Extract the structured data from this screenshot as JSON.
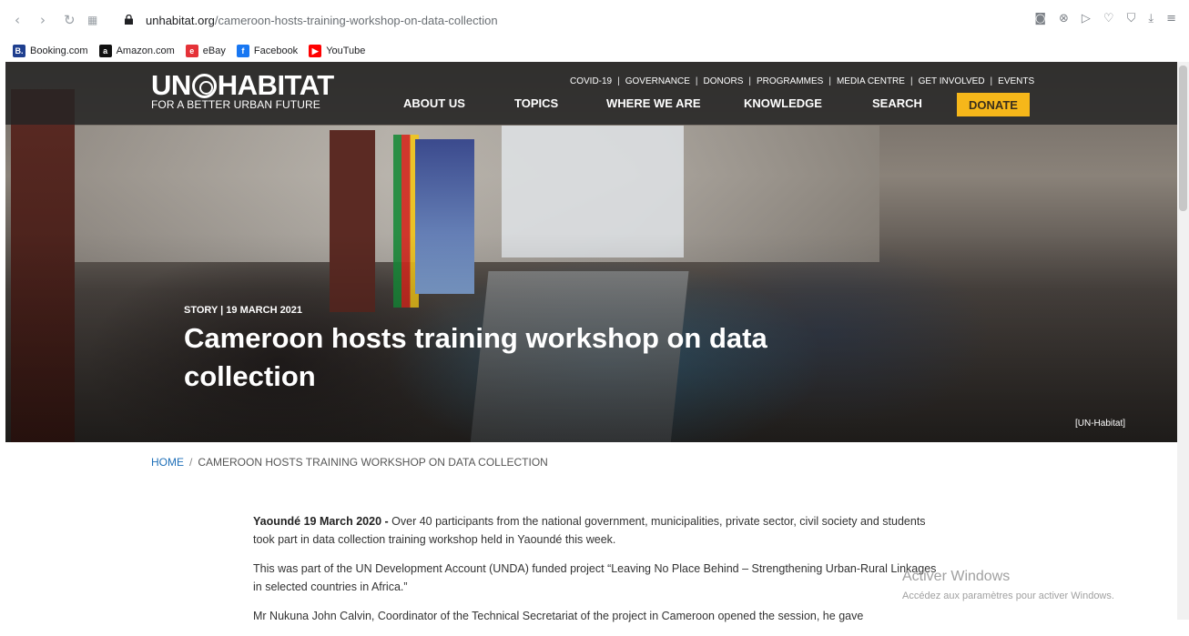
{
  "browser": {
    "url_host": "unhabitat.org",
    "url_path": "/cameroon-hosts-training-workshop-on-data-collection",
    "bookmarks": [
      {
        "label": "Booking.com",
        "icon": "booking-icon",
        "color": "#1f3f8f",
        "glyph": "B."
      },
      {
        "label": "Amazon.com",
        "icon": "amazon-icon",
        "color": "#111111",
        "glyph": "a"
      },
      {
        "label": "eBay",
        "icon": "ebay-icon",
        "color": "#e53238",
        "glyph": "e"
      },
      {
        "label": "Facebook",
        "icon": "facebook-icon",
        "color": "#1877f2",
        "glyph": "f"
      },
      {
        "label": "YouTube",
        "icon": "youtube-icon",
        "color": "#ff0000",
        "glyph": "▶"
      }
    ]
  },
  "site": {
    "logo_main_left": "UN",
    "logo_main_right": "HABITAT",
    "logo_sub": "FOR A BETTER URBAN FUTURE",
    "utility_links": [
      "COVID-19",
      "GOVERNANCE",
      "DONORS",
      "PROGRAMMES",
      "MEDIA CENTRE",
      "GET INVOLVED",
      "EVENTS"
    ],
    "main_nav": {
      "about": "ABOUT US",
      "topics": "TOPICS",
      "where": "WHERE WE ARE",
      "knowledge": "KNOWLEDGE",
      "search": "SEARCH",
      "donate": "DONATE"
    },
    "accent_color": "#f6b71a"
  },
  "hero": {
    "meta": "STORY | 19 MARCH 2021",
    "title": "Cameroon hosts training workshop on data collection",
    "credit": "[UN-Habitat]"
  },
  "breadcrumb": {
    "home": "HOME",
    "separator": "/",
    "current": "CAMEROON HOSTS TRAINING WORKSHOP ON DATA COLLECTION"
  },
  "article": {
    "p1_lead": "Yaoundé 19 March 2020 -",
    "p1_rest": " Over 40 participants from the national government, municipalities, private sector, civil society and students took part in data collection training workshop held in Yaoundé this week.",
    "p2": "This was part of the UN Development Account (UNDA) funded project “Leaving No Place Behind – Strengthening Urban-Rural Linkages in selected countries in Africa.”",
    "p3": "Mr Nukuna John Calvin, Coordinator of the Technical Secretariat of the project in Cameroon opened the session, he gave"
  },
  "watermark": {
    "title": "Activer Windows",
    "subtitle": "Accédez aux paramètres pour activer Windows."
  }
}
